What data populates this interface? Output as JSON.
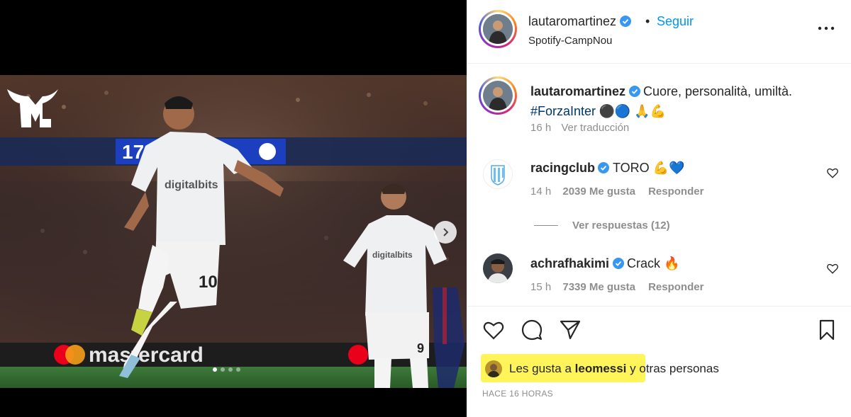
{
  "post": {
    "username": "lautaromartinez",
    "follow_label": "Seguir",
    "separator": "•",
    "location": "Spotify-CampNou"
  },
  "caption": {
    "username": "lautaromartinez",
    "text": "Cuore, personalità, umiltà.",
    "hashtag": "#ForzaInter",
    "emojis": "⚫🔵 🙏💪",
    "time": "16 h",
    "translate_label": "Ver traducción"
  },
  "comments": [
    {
      "username": "racingclub",
      "text": "TORO 💪💙",
      "time": "14 h",
      "likes": "2039 Me gusta",
      "reply_label": "Responder",
      "view_replies": "Ver respuestas (12)"
    },
    {
      "username": "achrafhakimi",
      "text": "Crack 🔥",
      "time": "15 h",
      "likes": "7339 Me gusta",
      "reply_label": "Responder"
    }
  ],
  "likes_summary": {
    "prefix": "Les gusta a",
    "user": "leomessi",
    "suffix": "y otras personas"
  },
  "timestamp": "HACE 16 HORAS",
  "media": {
    "banner_text": "mastercard",
    "sponsor_text": "digitalbits",
    "scoreboard": "17",
    "jersey_main": "10",
    "jersey_secondary": "9"
  },
  "colors": {
    "follow": "#0095f6",
    "verified": "#3897f0",
    "highlight": "#fff55a",
    "hashtag": "#00376b",
    "meta": "#8e8e8e"
  },
  "icons": [
    "ml-logo-icon",
    "chevron-right-icon",
    "verified-icon",
    "more-icon",
    "heart-icon",
    "comment-icon",
    "share-icon",
    "bookmark-icon"
  ]
}
